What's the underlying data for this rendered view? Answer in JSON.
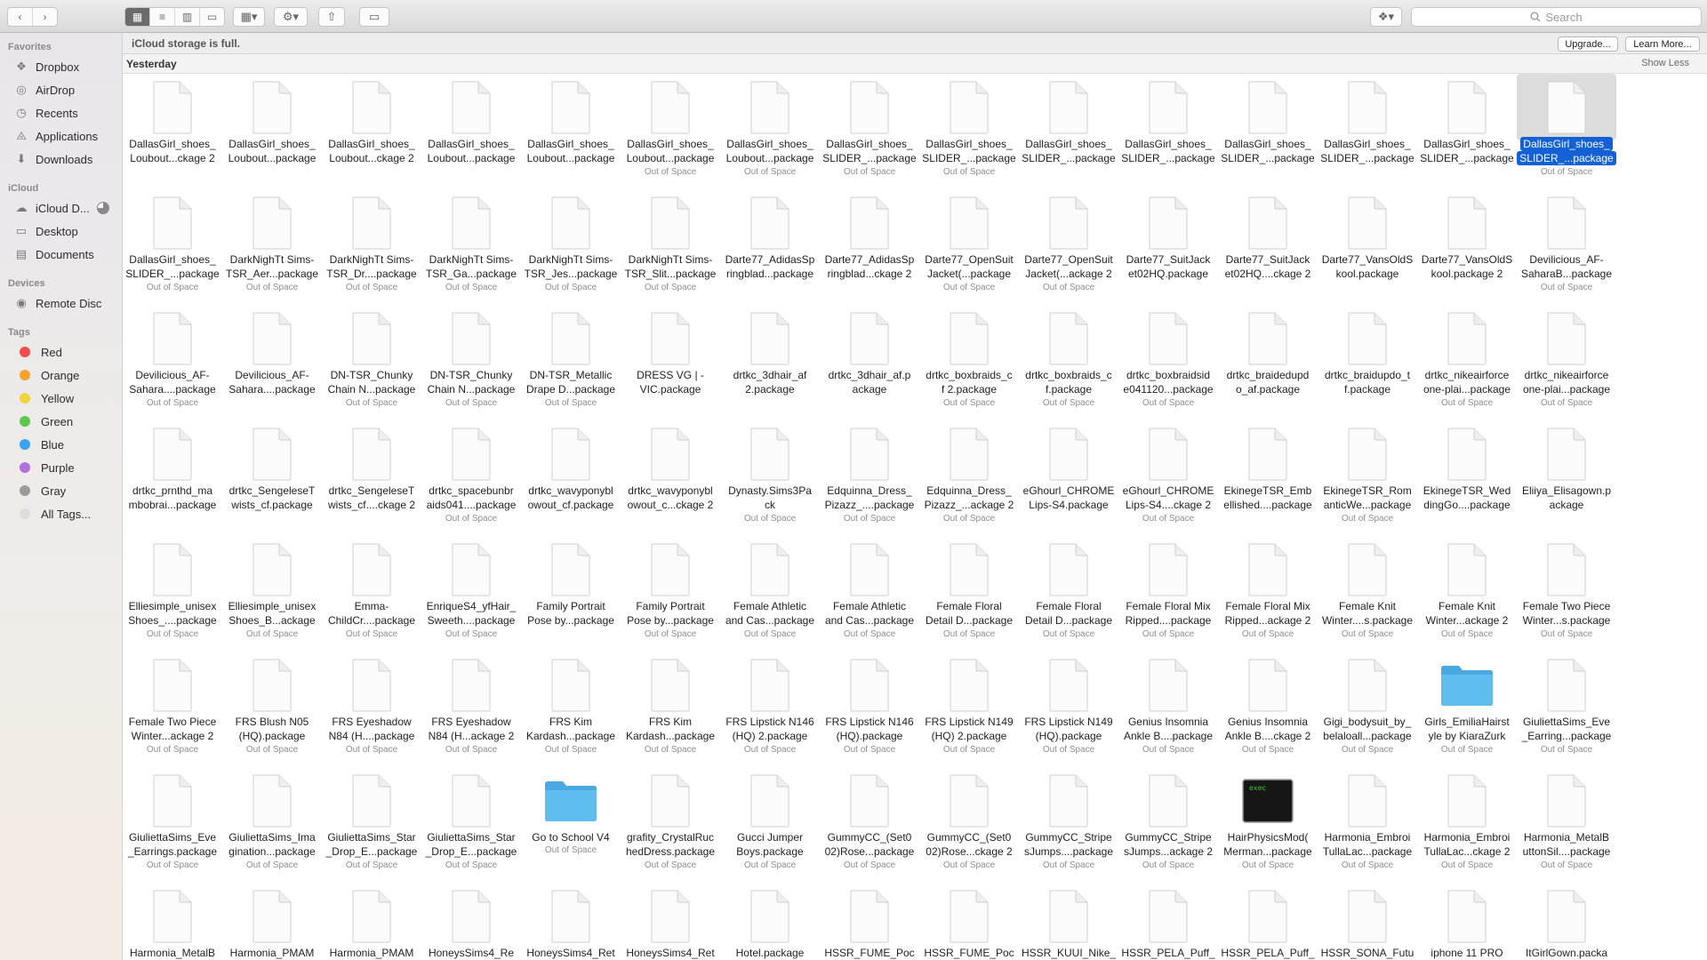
{
  "toolbar": {
    "back_icon": "chevron-left-icon",
    "forward_icon": "chevron-right-icon",
    "view_modes": [
      "icon-view-icon",
      "list-view-icon",
      "column-view-icon",
      "gallery-view-icon"
    ],
    "group_icon": "group-by-icon",
    "action_icon": "gear-icon",
    "share_icon": "share-icon",
    "tags_icon": "tag-icon",
    "dropbox_icon": "dropbox-icon",
    "search_placeholder": "Search"
  },
  "sidebar": {
    "sections": [
      {
        "title": "Favorites",
        "items": [
          {
            "label": "Dropbox",
            "icon": "dropbox-icon"
          },
          {
            "label": "AirDrop",
            "icon": "airdrop-icon"
          },
          {
            "label": "Recents",
            "icon": "clock-icon"
          },
          {
            "label": "Applications",
            "icon": "applications-icon"
          },
          {
            "label": "Downloads",
            "icon": "downloads-icon"
          }
        ]
      },
      {
        "title": "iCloud",
        "items": [
          {
            "label": "iCloud D...",
            "icon": "cloud-icon"
          },
          {
            "label": "Desktop",
            "icon": "desktop-icon"
          },
          {
            "label": "Documents",
            "icon": "document-icon"
          }
        ]
      },
      {
        "title": "Devices",
        "items": [
          {
            "label": "Remote Disc",
            "icon": "disc-icon"
          }
        ]
      },
      {
        "title": "Tags",
        "items": [
          {
            "label": "Red",
            "color": "#f24c4c"
          },
          {
            "label": "Orange",
            "color": "#f5a32b"
          },
          {
            "label": "Yellow",
            "color": "#f2d33a"
          },
          {
            "label": "Green",
            "color": "#5bc84b"
          },
          {
            "label": "Blue",
            "color": "#3aa3f0"
          },
          {
            "label": "Purple",
            "color": "#b06fdc"
          },
          {
            "label": "Gray",
            "color": "#9a9a9a"
          },
          {
            "label": "All Tags...",
            "color": "#dddddd"
          }
        ]
      }
    ]
  },
  "banner": {
    "message": "iCloud storage is full.",
    "upgrade": "Upgrade...",
    "learn_more": "Learn More..."
  },
  "group": {
    "title": "Yesterday",
    "toggle": "Show Less"
  },
  "files": [
    {
      "l1": "DallasGirl_shoes_",
      "l2": "Loubout...ckage 2",
      "sub": ""
    },
    {
      "l1": "DallasGirl_shoes_",
      "l2": "Loubout...package",
      "sub": ""
    },
    {
      "l1": "DallasGirl_shoes_",
      "l2": "Loubout...ckage 2",
      "sub": ""
    },
    {
      "l1": "DallasGirl_shoes_",
      "l2": "Loubout...package",
      "sub": ""
    },
    {
      "l1": "DallasGirl_shoes_",
      "l2": "Loubout...package",
      "sub": ""
    },
    {
      "l1": "DallasGirl_shoes_",
      "l2": "Loubout...package",
      "sub": "Out of Space"
    },
    {
      "l1": "DallasGirl_shoes_",
      "l2": "Loubout...package",
      "sub": "Out of Space"
    },
    {
      "l1": "DallasGirl_shoes_",
      "l2": "SLIDER_...package",
      "sub": "Out of Space"
    },
    {
      "l1": "DallasGirl_shoes_",
      "l2": "SLIDER_...package",
      "sub": "Out of Space"
    },
    {
      "l1": "DallasGirl_shoes_",
      "l2": "SLIDER_...package",
      "sub": ""
    },
    {
      "l1": "DallasGirl_shoes_",
      "l2": "SLIDER_...package",
      "sub": ""
    },
    {
      "l1": "DallasGirl_shoes_",
      "l2": "SLIDER_...package",
      "sub": ""
    },
    {
      "l1": "DallasGirl_shoes_",
      "l2": "SLIDER_...package",
      "sub": ""
    },
    {
      "l1": "DallasGirl_shoes_",
      "l2": "SLIDER_...package",
      "sub": ""
    },
    {
      "l1": "DallasGirl_shoes_",
      "l2": "SLIDER_...package",
      "sub": "Out of Space",
      "selected": true
    },
    {
      "l1": "DallasGirl_shoes_",
      "l2": "SLIDER_...package",
      "sub": "Out of Space"
    },
    {
      "l1": "DarkNighTt Sims-",
      "l2": "TSR_Aer...package",
      "sub": "Out of Space"
    },
    {
      "l1": "DarkNighTt Sims-",
      "l2": "TSR_Dr....package",
      "sub": "Out of Space"
    },
    {
      "l1": "DarkNighTt Sims-",
      "l2": "TSR_Ga...package",
      "sub": "Out of Space"
    },
    {
      "l1": "DarkNighTt Sims-",
      "l2": "TSR_Jes...package",
      "sub": "Out of Space"
    },
    {
      "l1": "DarkNighTt Sims-",
      "l2": "TSR_Slit...package",
      "sub": "Out of Space"
    },
    {
      "l1": "Darte77_AdidasSp",
      "l2": "ringblad...package",
      "sub": ""
    },
    {
      "l1": "Darte77_AdidasSp",
      "l2": "ringblad...ckage 2",
      "sub": ""
    },
    {
      "l1": "Darte77_OpenSuit",
      "l2": "Jacket(...package",
      "sub": "Out of Space"
    },
    {
      "l1": "Darte77_OpenSuit",
      "l2": "Jacket(...ackage 2",
      "sub": "Out of Space"
    },
    {
      "l1": "Darte77_SuitJack",
      "l2": "et02HQ.package",
      "sub": ""
    },
    {
      "l1": "Darte77_SuitJack",
      "l2": "et02HQ....ckage 2",
      "sub": ""
    },
    {
      "l1": "Darte77_VansOldS",
      "l2": "kool.package",
      "sub": ""
    },
    {
      "l1": "Darte77_VansOldS",
      "l2": "kool.package 2",
      "sub": ""
    },
    {
      "l1": "Devilicious_AF-",
      "l2": "SaharaB...package",
      "sub": "Out of Space"
    },
    {
      "l1": "Devilicious_AF-",
      "l2": "Sahara....package",
      "sub": "Out of Space"
    },
    {
      "l1": "Devilicious_AF-",
      "l2": "Sahara....package",
      "sub": ""
    },
    {
      "l1": "DN-TSR_Chunky",
      "l2": "Chain N...package",
      "sub": "Out of Space"
    },
    {
      "l1": "DN-TSR_Chunky",
      "l2": "Chain N...package",
      "sub": "Out of Space"
    },
    {
      "l1": "DN-TSR_Metallic",
      "l2": "Drape D...package",
      "sub": "Out of Space"
    },
    {
      "l1": "DRESS VG | -",
      "l2": "VIC.package",
      "sub": ""
    },
    {
      "l1": "drtkc_3dhair_af",
      "l2": "2.package",
      "sub": ""
    },
    {
      "l1": "drtkc_3dhair_af.p",
      "l2": "ackage",
      "sub": ""
    },
    {
      "l1": "drtkc_boxbraids_c",
      "l2": "f 2.package",
      "sub": "Out of Space"
    },
    {
      "l1": "drtkc_boxbraids_c",
      "l2": "f.package",
      "sub": "Out of Space"
    },
    {
      "l1": "drtkc_boxbraidsid",
      "l2": "e041120...package",
      "sub": "Out of Space"
    },
    {
      "l1": "drtkc_braidedupd",
      "l2": "o_af.package",
      "sub": ""
    },
    {
      "l1": "drtkc_braidupdo_t",
      "l2": "f.package",
      "sub": ""
    },
    {
      "l1": "drtkc_nikeairforce",
      "l2": "one-plai...package",
      "sub": "Out of Space"
    },
    {
      "l1": "drtkc_nikeairforce",
      "l2": "one-plai...package",
      "sub": "Out of Space"
    },
    {
      "l1": "drtkc_prnthd_ma",
      "l2": "mbobrai...package",
      "sub": ""
    },
    {
      "l1": "drtkc_SengeleseT",
      "l2": "wists_cf.package",
      "sub": ""
    },
    {
      "l1": "drtkc_SengeleseT",
      "l2": "wists_cf....ckage 2",
      "sub": ""
    },
    {
      "l1": "drtkc_spacebunbr",
      "l2": "aids041....package",
      "sub": "Out of Space"
    },
    {
      "l1": "drtkc_wavyponybl",
      "l2": "owout_cf.package",
      "sub": ""
    },
    {
      "l1": "drtkc_wavyponybl",
      "l2": "owout_c...ckage 2",
      "sub": ""
    },
    {
      "l1": "Dynasty.Sims3Pa",
      "l2": "ck",
      "sub": "Out of Space"
    },
    {
      "l1": "Edquinna_Dress_",
      "l2": "Pizazz_....package",
      "sub": "Out of Space"
    },
    {
      "l1": "Edquinna_Dress_",
      "l2": "Pizazz_...ackage 2",
      "sub": "Out of Space"
    },
    {
      "l1": "eGhourl_CHROME",
      "l2": "Lips-S4.package",
      "sub": ""
    },
    {
      "l1": "eGhourl_CHROME",
      "l2": "Lips-S4....ckage 2",
      "sub": "Out of Space"
    },
    {
      "l1": "EkinegeTSR_Emb",
      "l2": "ellished....package",
      "sub": ""
    },
    {
      "l1": "EkinegeTSR_Rom",
      "l2": "anticWe...package",
      "sub": "Out of Space"
    },
    {
      "l1": "EkinegeTSR_Wed",
      "l2": "dingGo....package",
      "sub": ""
    },
    {
      "l1": "Eliiya_Elisagown.p",
      "l2": "ackage",
      "sub": ""
    },
    {
      "l1": "Elliesimple_unisex",
      "l2": "Shoes_....package",
      "sub": "Out of Space"
    },
    {
      "l1": "Elliesimple_unisex",
      "l2": "Shoes_B...ackage",
      "sub": "Out of Space"
    },
    {
      "l1": "Emma-",
      "l2": "ChildCr....package",
      "sub": "Out of Space"
    },
    {
      "l1": "EnriqueS4_yfHair_",
      "l2": "Sweeth....package",
      "sub": "Out of Space"
    },
    {
      "l1": "Family Portrait",
      "l2": "Pose by...package",
      "sub": ""
    },
    {
      "l1": "Family Portrait",
      "l2": "Pose by...package",
      "sub": "Out of Space"
    },
    {
      "l1": "Female Athletic",
      "l2": "and Cas...package",
      "sub": "Out of Space"
    },
    {
      "l1": "Female Athletic",
      "l2": "and Cas...package",
      "sub": "Out of Space"
    },
    {
      "l1": "Female Floral",
      "l2": "Detail D...package",
      "sub": "Out of Space"
    },
    {
      "l1": "Female Floral",
      "l2": "Detail D...package",
      "sub": "Out of Space"
    },
    {
      "l1": "Female Floral Mix",
      "l2": "Ripped....package",
      "sub": "Out of Space"
    },
    {
      "l1": "Female Floral Mix",
      "l2": "Ripped...ackage 2",
      "sub": "Out of Space"
    },
    {
      "l1": "Female Knit",
      "l2": "Winter....s.package",
      "sub": "Out of Space"
    },
    {
      "l1": "Female Knit",
      "l2": "Winter...ackage 2",
      "sub": "Out of Space"
    },
    {
      "l1": "Female Two Piece",
      "l2": "Winter...s.package",
      "sub": "Out of Space"
    },
    {
      "l1": "Female Two Piece",
      "l2": "Winter...ackage 2",
      "sub": "Out of Space"
    },
    {
      "l1": "FRS Blush N05",
      "l2": "(HQ).package",
      "sub": "Out of Space"
    },
    {
      "l1": "FRS Eyeshadow",
      "l2": "N84 (H....package",
      "sub": "Out of Space"
    },
    {
      "l1": "FRS Eyeshadow",
      "l2": "N84 (H...ackage 2",
      "sub": "Out of Space"
    },
    {
      "l1": "FRS Kim",
      "l2": "Kardash...package",
      "sub": "Out of Space"
    },
    {
      "l1": "FRS Kim",
      "l2": "Kardash...package",
      "sub": "Out of Space"
    },
    {
      "l1": "FRS Lipstick N146",
      "l2": "(HQ) 2.package",
      "sub": "Out of Space"
    },
    {
      "l1": "FRS Lipstick N146",
      "l2": "(HQ).package",
      "sub": "Out of Space"
    },
    {
      "l1": "FRS Lipstick N149",
      "l2": "(HQ) 2.package",
      "sub": "Out of Space"
    },
    {
      "l1": "FRS Lipstick N149",
      "l2": "(HQ).package",
      "sub": "Out of Space"
    },
    {
      "l1": "Genius Insomnia",
      "l2": "Ankle B....package",
      "sub": "Out of Space"
    },
    {
      "l1": "Genius Insomnia",
      "l2": "Ankle B....ckage 2",
      "sub": "Out of Space"
    },
    {
      "l1": "Gigi_bodysuit_by_",
      "l2": "belaloall...package",
      "sub": "Out of Space"
    },
    {
      "l1": "Girls_EmiliaHairst",
      "l2": "yle by KiaraZurk",
      "sub": "Out of Space",
      "kind": "folder"
    },
    {
      "l1": "GiuliettaSims_Eve",
      "l2": "_Earring...package",
      "sub": "Out of Space"
    },
    {
      "l1": "GiuliettaSims_Eve",
      "l2": "_Earrings.package",
      "sub": "Out of Space"
    },
    {
      "l1": "GiuliettaSims_Ima",
      "l2": "gination...package",
      "sub": "Out of Space"
    },
    {
      "l1": "GiuliettaSims_Star",
      "l2": "_Drop_E...package",
      "sub": "Out of Space"
    },
    {
      "l1": "GiuliettaSims_Star",
      "l2": "_Drop_E...package",
      "sub": "Out of Space"
    },
    {
      "l1": "Go to School V4",
      "l2": "",
      "sub": "Out of Space",
      "kind": "folder"
    },
    {
      "l1": "grafity_CrystalRuc",
      "l2": "hedDress.package",
      "sub": "Out of Space"
    },
    {
      "l1": "Gucci Jumper",
      "l2": "Boys.package",
      "sub": "Out of Space"
    },
    {
      "l1": "GummyCC_(Set0",
      "l2": "02)Rose...package",
      "sub": "Out of Space"
    },
    {
      "l1": "GummyCC_(Set0",
      "l2": "02)Rose...ckage 2",
      "sub": "Out of Space"
    },
    {
      "l1": "GummyCC_Stripe",
      "l2": "sJumps....package",
      "sub": "Out of Space"
    },
    {
      "l1": "GummyCC_Stripe",
      "l2": "sJumps...ackage 2",
      "sub": "Out of Space"
    },
    {
      "l1": "HairPhysicsMod(",
      "l2": "Merman...package",
      "sub": "Out of Space",
      "kind": "exec"
    },
    {
      "l1": "Harmonia_Embroi",
      "l2": "TullaLac...package",
      "sub": "Out of Space"
    },
    {
      "l1": "Harmonia_Embroi",
      "l2": "TullaLac...ckage 2",
      "sub": "Out of Space"
    },
    {
      "l1": "Harmonia_MetalB",
      "l2": "uttonSil....package",
      "sub": "Out of Space"
    },
    {
      "l1": "Harmonia_MetalB",
      "l2": "",
      "sub": ""
    },
    {
      "l1": "Harmonia_PMAM",
      "l2": "",
      "sub": ""
    },
    {
      "l1": "Harmonia_PMAM",
      "l2": "",
      "sub": ""
    },
    {
      "l1": "HoneysSims4_Re",
      "l2": "",
      "sub": ""
    },
    {
      "l1": "HoneysSims4_Ret",
      "l2": "",
      "sub": ""
    },
    {
      "l1": "HoneysSims4_Ret",
      "l2": "",
      "sub": ""
    },
    {
      "l1": "Hotel.package",
      "l2": "",
      "sub": ""
    },
    {
      "l1": "HSSR_FUME_Poc",
      "l2": "",
      "sub": ""
    },
    {
      "l1": "HSSR_FUME_Poc",
      "l2": "",
      "sub": ""
    },
    {
      "l1": "HSSR_KUUI_Nike_",
      "l2": "",
      "sub": ""
    },
    {
      "l1": "HSSR_PELA_Puff_",
      "l2": "",
      "sub": ""
    },
    {
      "l1": "HSSR_PELA_Puff_",
      "l2": "",
      "sub": ""
    },
    {
      "l1": "HSSR_SONA_Futu",
      "l2": "",
      "sub": ""
    },
    {
      "l1": "iphone 11 PRO",
      "l2": "",
      "sub": ""
    },
    {
      "l1": "ItGirlGown.packa",
      "l2": "",
      "sub": ""
    }
  ],
  "colors": {
    "selection": "#1461d6",
    "folder": "#5fbdf0"
  }
}
